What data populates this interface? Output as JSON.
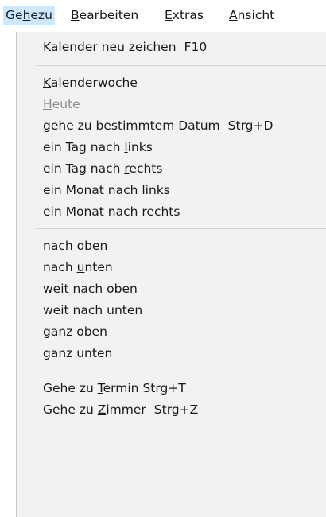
{
  "menubar": {
    "items": [
      {
        "pre": "Ge",
        "ul": "h",
        "post": "ezu"
      },
      {
        "pre": "",
        "ul": "B",
        "post": "earbeiten"
      },
      {
        "pre": "",
        "ul": "E",
        "post": "xtras"
      },
      {
        "pre": "",
        "ul": "A",
        "post": "nsicht"
      }
    ]
  },
  "menu": {
    "groups": [
      [
        {
          "pre": "Kalender neu ",
          "ul": "z",
          "post": "eichen",
          "shortcut": "F10",
          "enabled": true
        }
      ],
      [
        {
          "pre": "",
          "ul": "K",
          "post": "alenderwoche",
          "shortcut": "",
          "enabled": true
        },
        {
          "pre": "",
          "ul": "H",
          "post": "eute",
          "shortcut": "",
          "enabled": false
        },
        {
          "pre": "gehe zu bestimmtem Datum",
          "ul": "",
          "post": "",
          "shortcut": "Strg+D",
          "enabled": true
        },
        {
          "pre": "ein Tag nach ",
          "ul": "l",
          "post": "inks",
          "shortcut": "",
          "enabled": true
        },
        {
          "pre": "ein Tag nach ",
          "ul": "r",
          "post": "echts",
          "shortcut": "",
          "enabled": true
        },
        {
          "pre": "ein Monat nach links",
          "ul": "",
          "post": "",
          "shortcut": "",
          "enabled": true
        },
        {
          "pre": "ein Monat nach rechts",
          "ul": "",
          "post": "",
          "shortcut": "",
          "enabled": true
        }
      ],
      [
        {
          "pre": "nach ",
          "ul": "o",
          "post": "ben",
          "shortcut": "",
          "enabled": true
        },
        {
          "pre": "nach ",
          "ul": "u",
          "post": "nten",
          "shortcut": "",
          "enabled": true
        },
        {
          "pre": "weit nach oben",
          "ul": "",
          "post": "",
          "shortcut": "",
          "enabled": true
        },
        {
          "pre": "weit nach unten",
          "ul": "",
          "post": "",
          "shortcut": "",
          "enabled": true
        },
        {
          "pre": "ganz oben",
          "ul": "",
          "post": "",
          "shortcut": "",
          "enabled": true
        },
        {
          "pre": "ganz unten",
          "ul": "",
          "post": "",
          "shortcut": "",
          "enabled": true
        }
      ],
      [
        {
          "pre": "Gehe zu ",
          "ul": "T",
          "post": "ermin",
          "shortcut": "Strg+T",
          "enabled": true
        },
        {
          "pre": "Gehe zu ",
          "ul": "Z",
          "post": "immer",
          "shortcut": "Strg+Z",
          "enabled": true
        }
      ]
    ]
  }
}
